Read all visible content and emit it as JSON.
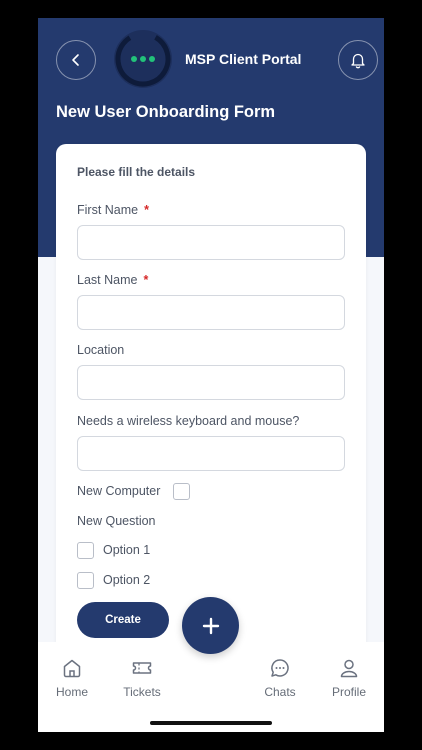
{
  "header": {
    "app_title": "MSP Client Portal",
    "page_title": "New User Onboarding Form"
  },
  "form": {
    "subtitle": "Please fill the details",
    "fields": [
      {
        "label": "First Name",
        "required": "*",
        "value": ""
      },
      {
        "label": "Last Name",
        "required": "*",
        "value": ""
      },
      {
        "label": "Location",
        "value": ""
      },
      {
        "label": "Needs a wireless keyboard and mouse?",
        "value": ""
      }
    ],
    "new_computer_label": "New Computer",
    "new_question_label": "New Question",
    "options": [
      "Option 1",
      "Option 2"
    ],
    "create_label": "Create"
  },
  "nav": {
    "items": [
      {
        "label": "Home",
        "icon": "home-icon"
      },
      {
        "label": "Tickets",
        "icon": "ticket-icon"
      },
      {
        "label": "Chats",
        "icon": "chat-icon"
      },
      {
        "label": "Profile",
        "icon": "profile-icon"
      }
    ]
  },
  "colors": {
    "primary": "#243a6e",
    "accent_dots": "#22c27a",
    "required": "#d62828"
  }
}
